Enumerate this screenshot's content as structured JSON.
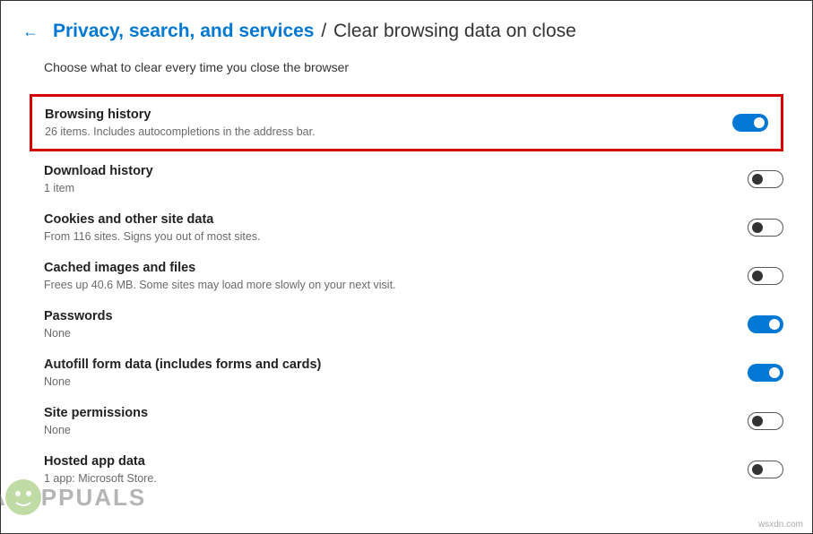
{
  "breadcrumb": {
    "link": "Privacy, search, and services",
    "sep": "/",
    "current": "Clear browsing data on close"
  },
  "subhead": "Choose what to clear every time you close the browser",
  "items": [
    {
      "title": "Browsing history",
      "sub": "26 items. Includes autocompletions in the address bar.",
      "on": true,
      "highlight": true,
      "name": "browsing-history"
    },
    {
      "title": "Download history",
      "sub": "1 item",
      "on": false,
      "highlight": false,
      "name": "download-history"
    },
    {
      "title": "Cookies and other site data",
      "sub": "From 116 sites. Signs you out of most sites.",
      "on": false,
      "highlight": false,
      "name": "cookies"
    },
    {
      "title": "Cached images and files",
      "sub": "Frees up 40.6 MB. Some sites may load more slowly on your next visit.",
      "on": false,
      "highlight": false,
      "name": "cached-files"
    },
    {
      "title": "Passwords",
      "sub": "None",
      "on": true,
      "highlight": false,
      "name": "passwords"
    },
    {
      "title": "Autofill form data (includes forms and cards)",
      "sub": "None",
      "on": true,
      "highlight": false,
      "name": "autofill"
    },
    {
      "title": "Site permissions",
      "sub": "None",
      "on": false,
      "highlight": false,
      "name": "site-permissions"
    },
    {
      "title": "Hosted app data",
      "sub": "1 app: Microsoft Store.",
      "on": false,
      "highlight": false,
      "name": "hosted-app-data"
    }
  ],
  "watermark": "PPUALS",
  "credit": "wsxdn.com"
}
